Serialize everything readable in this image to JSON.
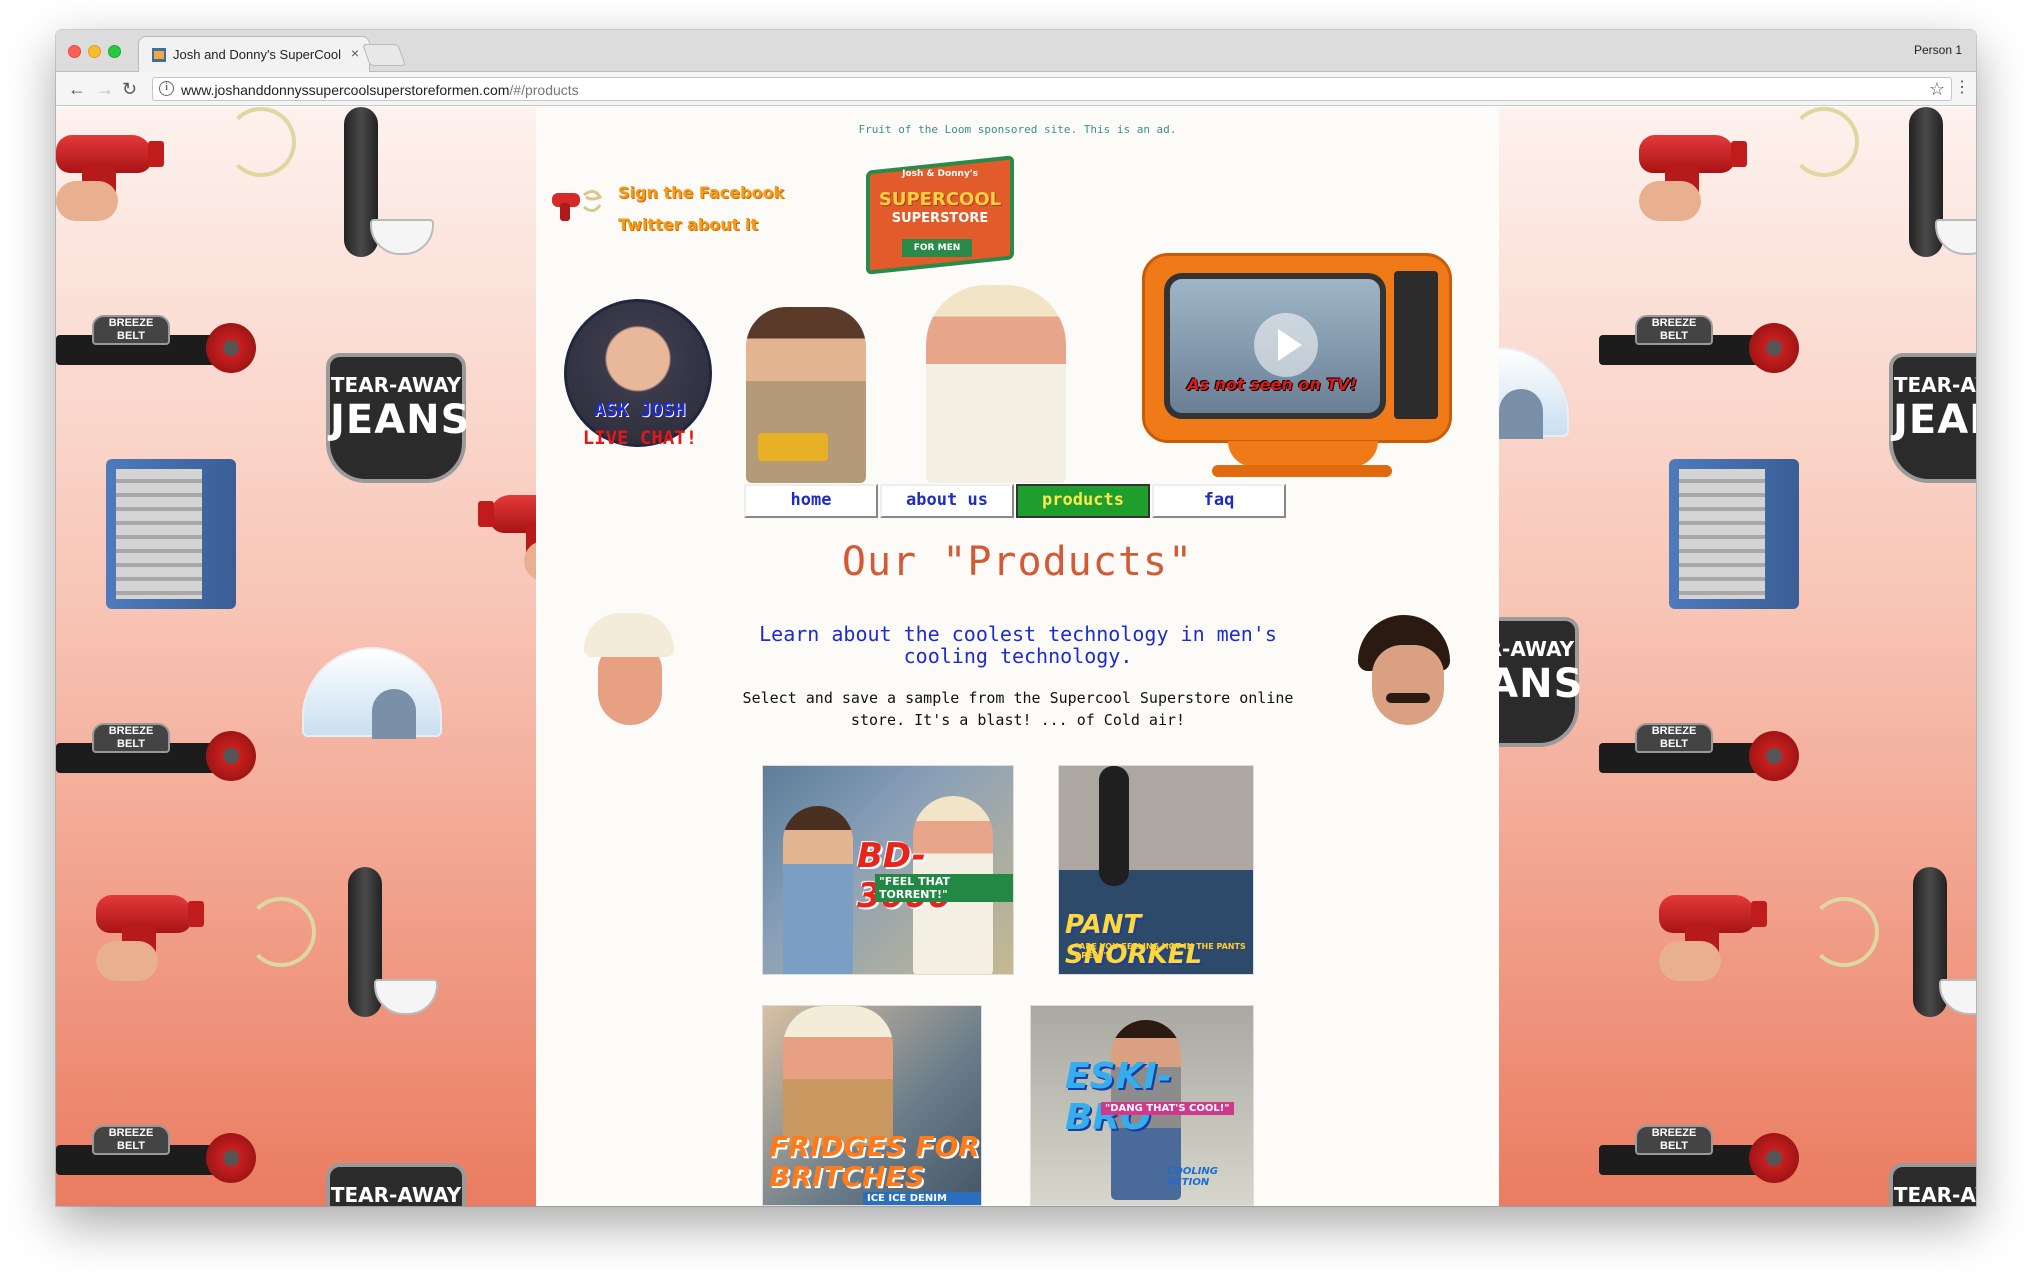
{
  "browser": {
    "tab_title": "Josh and Donny's SuperCool",
    "tab_close": "×",
    "profile": "Person 1",
    "url_host": "www.joshanddonnyssupercoolsuperstoreformen.com",
    "url_path": "/#/products",
    "info": "i",
    "back": "←",
    "forward": "→",
    "reload": "↻",
    "star": "☆",
    "menu": "⋮"
  },
  "header": {
    "ad_note": "Fruit of the Loom sponsored site. This is an ad.",
    "facebook_link": "Sign the Facebook",
    "twitter_link": "Twitter about it",
    "logo_small": "Josh & Donny's",
    "logo_main": "SUPERCOOL",
    "logo_sub": "SUPERSTORE",
    "logo_tag": "FOR MEN",
    "ask_josh": "ASK JOSH",
    "live_chat": "LIVE CHAT!",
    "tv_caption": "As not seen on TV!"
  },
  "nav": {
    "items": [
      {
        "label": "home",
        "active": false
      },
      {
        "label": "about us",
        "active": false
      },
      {
        "label": "products",
        "active": true
      },
      {
        "label": "faq",
        "active": false
      }
    ]
  },
  "main": {
    "title": "Our \"Products\"",
    "subtitle": "Learn about the coolest technology in men's cooling technology.",
    "description": "Select and save a sample from the Supercool Superstore online store. It's a blast! ... of Cold air!"
  },
  "products": [
    {
      "name": "BD-3000",
      "tagline": "\"FEEL THAT TORRENT!\""
    },
    {
      "name": "PANT SNORKEL",
      "tagline": "\"ARE YOU FEELING HOT IN THE PANTS AREA?\""
    },
    {
      "name": "FRIDGES FOR BRITCHES",
      "tagline": "ICE ICE DENIM BABY!"
    },
    {
      "name": "ESKI-BRO",
      "tagline": "\"DANG THAT'S COOL!\"",
      "tagline2": "COOLING ACTION"
    }
  ],
  "background": {
    "belt_label": "BREEZE BELT",
    "jeans_line1": "TEAR-AWAY",
    "jeans_line2": "JEANS"
  },
  "colors": {
    "nav_active_bg": "#1e9e2d",
    "nav_active_text": "#ffe84d",
    "title_color": "#d35a35",
    "link_blue": "#1e2bd0"
  }
}
